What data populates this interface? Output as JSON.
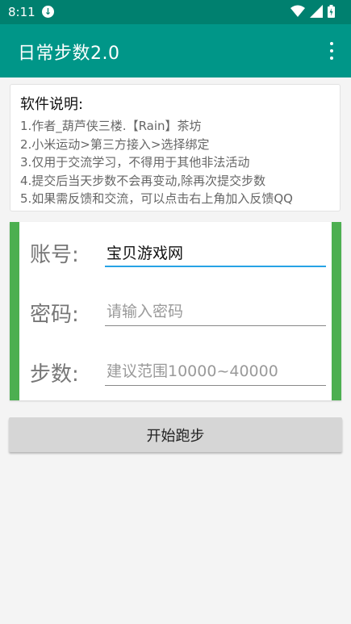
{
  "status_bar": {
    "time": "8:11",
    "icons": [
      "download-icon",
      "wifi-icon",
      "signal-icon",
      "battery-icon"
    ]
  },
  "app_bar": {
    "title": "日常步数2.0",
    "menu_icon": "more-vert-icon"
  },
  "info": {
    "heading": "软件说明:",
    "lines": [
      "1.作者_葫芦侠三楼.【Rain】茶坊",
      "2.小米运动>第三方接入>选择绑定",
      "3.仅用于交流学习，不得用于其他非法活动",
      "4.提交后当天步数不会再变动,除再次提交步数",
      "5.如果需反馈和交流，可以点击右上角加入反馈QQ"
    ]
  },
  "form": {
    "account": {
      "label": "账号:",
      "value": "宝贝游戏网",
      "placeholder": ""
    },
    "password": {
      "label": "密码:",
      "value": "",
      "placeholder": "请输入密码"
    },
    "steps": {
      "label": "步数:",
      "value": "",
      "placeholder": "建议范围10000~40000"
    }
  },
  "actions": {
    "start_label": "开始跑步"
  },
  "colors": {
    "primary": "#009688",
    "primary_dark": "#00806f",
    "accent_green": "#4caf50",
    "focus_blue": "#27a3e5"
  }
}
